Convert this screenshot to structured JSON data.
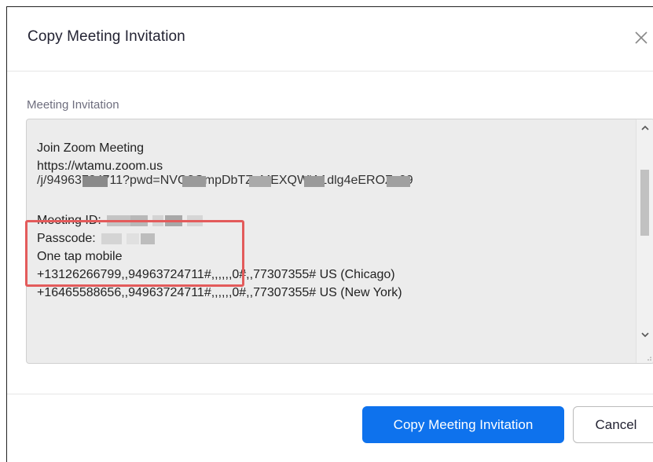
{
  "dialog": {
    "title": "Copy Meeting Invitation",
    "close_icon": "close-x-icon"
  },
  "invitation": {
    "label": "Meeting Invitation",
    "lines": {
      "join": "Join Zoom Meeting",
      "url": "https://wtamu.zoom.us",
      "url_blurred": "/j/94963724711?pwd=NVQ3QmpDbTZuMEXQWjA1dlg4eEROZz09",
      "meeting_id_label": "Meeting ID:",
      "passcode_label": "Passcode:",
      "one_tap": "One tap mobile",
      "dial_1": "+13126266799,,94963724711#,,,,,,0#,,77307355# US (Chicago)",
      "dial_2": "+16465588656,,94963724711#,,,,,,0#,,77307355# US (New York)"
    }
  },
  "buttons": {
    "copy": "Copy Meeting Invitation",
    "cancel": "Cancel"
  },
  "colors": {
    "primary": "#0e72ed",
    "highlight": "#e35b5b",
    "textarea_bg": "#ececec"
  }
}
